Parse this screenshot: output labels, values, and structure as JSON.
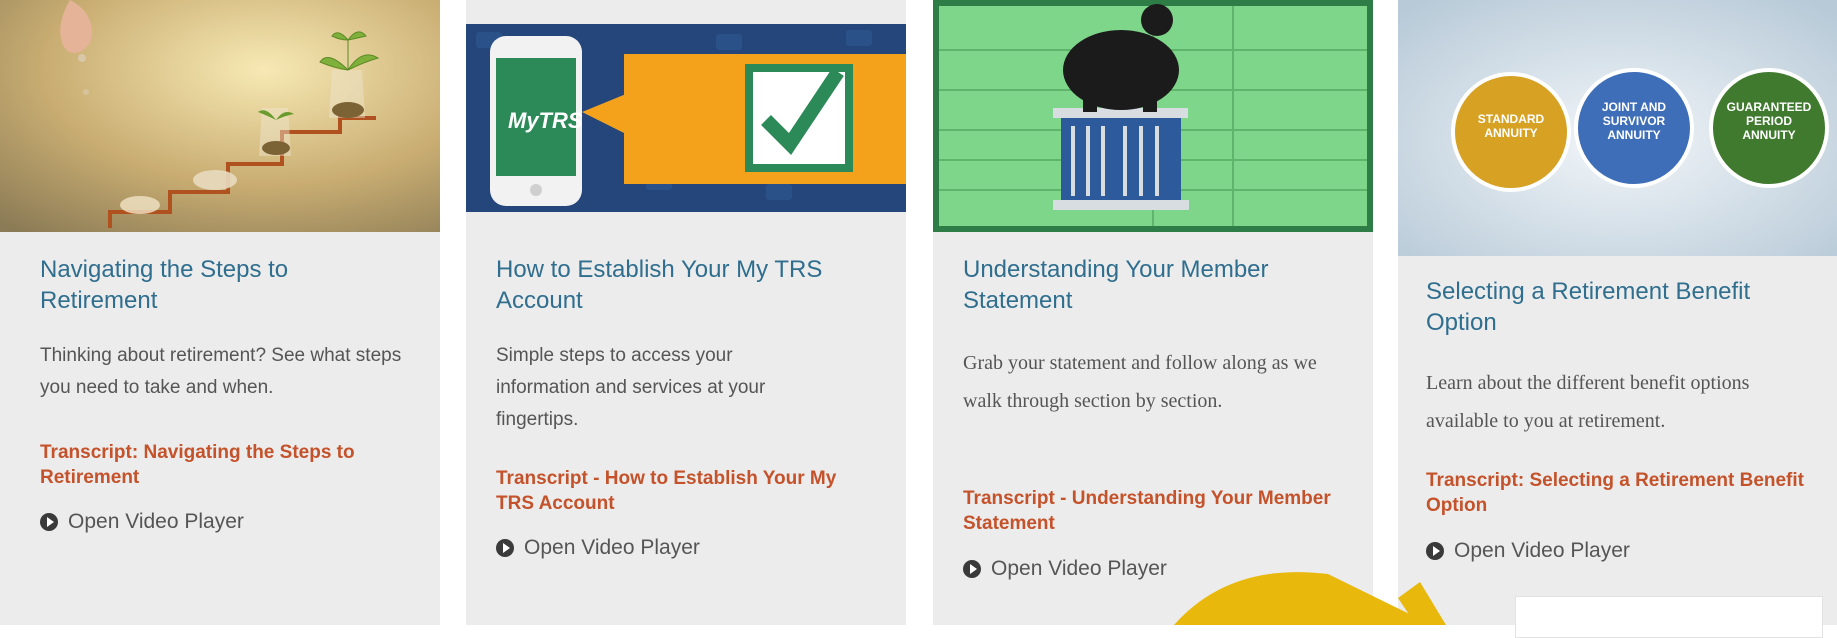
{
  "cards": [
    {
      "title": "Navigating the Steps to Retirement",
      "description": "Thinking about retirement? See what steps you need to take and when.",
      "transcript": "Transcript: Navigating the Steps to Retirement",
      "player": "Open Video Player"
    },
    {
      "title": "How to Establish Your My TRS Account",
      "description": "Simple steps to access your information and services at your fingertips.",
      "transcript": "Transcript - How to Establish Your My TRS Account",
      "player": "Open Video Player",
      "thumb_label": "MyTRS"
    },
    {
      "title": "Understanding Your Member Statement",
      "description": "Grab your statement and follow along as we walk through section by section.",
      "transcript": "Transcript - Understanding Your Member Statement",
      "player": "Open Video Player"
    },
    {
      "title": "Selecting a Retirement Benefit Option",
      "description": "Learn about the different benefit options available to you at retirement.",
      "transcript": "Transcript: Selecting a Retirement Benefit Option",
      "player": "Open Video Player",
      "annuities": [
        "STANDARD ANNUITY",
        "JOINT AND SURVIVOR ANNUITY",
        "GUARANTEED PERIOD ANNUITY"
      ]
    }
  ],
  "colors": {
    "title": "#2f6e8e",
    "transcript": "#c4522a",
    "card_bg": "#ececec",
    "arrow": "#e8b80c"
  }
}
